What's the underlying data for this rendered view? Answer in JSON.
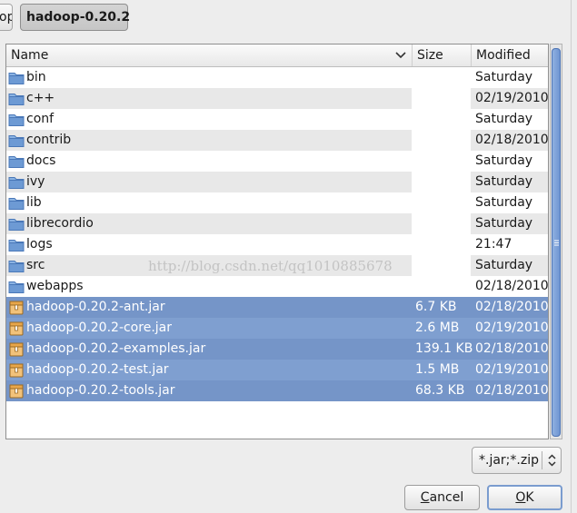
{
  "breadcrumb": {
    "prev_label": "op",
    "current_label": "hadoop-0.20.2"
  },
  "columns": {
    "name": "Name",
    "size": "Size",
    "modified": "Modified"
  },
  "files": [
    {
      "name": "bin",
      "size": "",
      "modified": "Saturday",
      "type": "folder",
      "selected": false
    },
    {
      "name": "c++",
      "size": "",
      "modified": "02/19/2010",
      "type": "folder",
      "selected": false
    },
    {
      "name": "conf",
      "size": "",
      "modified": "Saturday",
      "type": "folder",
      "selected": false
    },
    {
      "name": "contrib",
      "size": "",
      "modified": "02/18/2010",
      "type": "folder",
      "selected": false
    },
    {
      "name": "docs",
      "size": "",
      "modified": "Saturday",
      "type": "folder",
      "selected": false
    },
    {
      "name": "ivy",
      "size": "",
      "modified": "Saturday",
      "type": "folder",
      "selected": false
    },
    {
      "name": "lib",
      "size": "",
      "modified": "Saturday",
      "type": "folder",
      "selected": false
    },
    {
      "name": "librecordio",
      "size": "",
      "modified": "Saturday",
      "type": "folder",
      "selected": false
    },
    {
      "name": "logs",
      "size": "",
      "modified": "21:47",
      "type": "folder",
      "selected": false
    },
    {
      "name": "src",
      "size": "",
      "modified": "Saturday",
      "type": "folder",
      "selected": false
    },
    {
      "name": "webapps",
      "size": "",
      "modified": "02/18/2010",
      "type": "folder",
      "selected": false
    },
    {
      "name": "hadoop-0.20.2-ant.jar",
      "size": "6.7 KB",
      "modified": "02/18/2010",
      "type": "archive",
      "selected": true
    },
    {
      "name": "hadoop-0.20.2-core.jar",
      "size": "2.6 MB",
      "modified": "02/19/2010",
      "type": "archive",
      "selected": true
    },
    {
      "name": "hadoop-0.20.2-examples.jar",
      "size": "139.1 KB",
      "modified": "02/18/2010",
      "type": "archive",
      "selected": true
    },
    {
      "name": "hadoop-0.20.2-test.jar",
      "size": "1.5 MB",
      "modified": "02/19/2010",
      "type": "archive",
      "selected": true
    },
    {
      "name": "hadoop-0.20.2-tools.jar",
      "size": "68.3 KB",
      "modified": "02/18/2010",
      "type": "archive",
      "selected": true
    }
  ],
  "filter": {
    "selected": "*.jar;*.zip"
  },
  "buttons": {
    "cancel_mnemonic": "C",
    "cancel_rest": "ancel",
    "ok_mnemonic": "O",
    "ok_rest": "K"
  },
  "watermark": "http://blog.csdn.net/qq1010885678",
  "colors": {
    "selection": "#7f9fd0",
    "folder": "#6d9ad4",
    "archive": "#e8a64a"
  }
}
